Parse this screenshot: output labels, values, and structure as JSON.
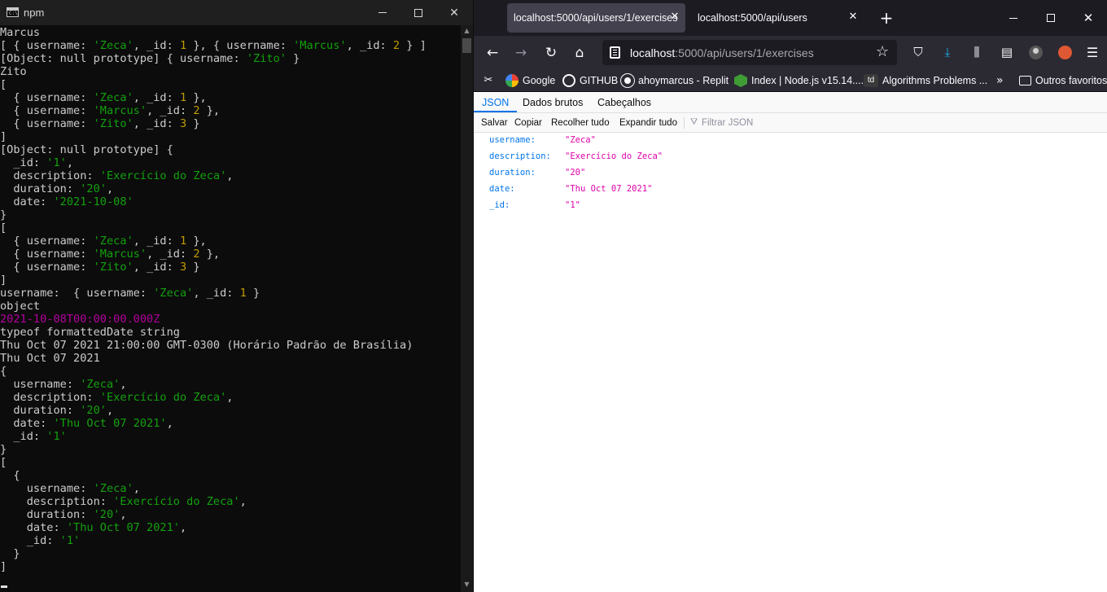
{
  "terminal": {
    "title": "npm",
    "icon_text": "C:\\",
    "lines": [
      [
        {
          "t": "Marcus"
        }
      ],
      [
        {
          "t": "[ { username: "
        },
        {
          "t": "'Zeca'",
          "c": "str"
        },
        {
          "t": ", _id: "
        },
        {
          "t": "1",
          "c": "num"
        },
        {
          "t": " }, { username: "
        },
        {
          "t": "'Marcus'",
          "c": "str"
        },
        {
          "t": ", _id: "
        },
        {
          "t": "2",
          "c": "num"
        },
        {
          "t": " } ]"
        }
      ],
      [
        {
          "t": "[Object: null prototype] { username: "
        },
        {
          "t": "'Zito'",
          "c": "str"
        },
        {
          "t": " }"
        }
      ],
      [
        {
          "t": "Zito"
        }
      ],
      [
        {
          "t": "["
        }
      ],
      [
        {
          "t": "  { username: "
        },
        {
          "t": "'Zeca'",
          "c": "str"
        },
        {
          "t": ", _id: "
        },
        {
          "t": "1",
          "c": "num"
        },
        {
          "t": " },"
        }
      ],
      [
        {
          "t": "  { username: "
        },
        {
          "t": "'Marcus'",
          "c": "str"
        },
        {
          "t": ", _id: "
        },
        {
          "t": "2",
          "c": "num"
        },
        {
          "t": " },"
        }
      ],
      [
        {
          "t": "  { username: "
        },
        {
          "t": "'Zito'",
          "c": "str"
        },
        {
          "t": ", _id: "
        },
        {
          "t": "3",
          "c": "num"
        },
        {
          "t": " }"
        }
      ],
      [
        {
          "t": "]"
        }
      ],
      [
        {
          "t": "[Object: null prototype] {"
        }
      ],
      [
        {
          "t": "  _id: "
        },
        {
          "t": "'1'",
          "c": "str"
        },
        {
          "t": ","
        }
      ],
      [
        {
          "t": "  description: "
        },
        {
          "t": "'Exercício do Zeca'",
          "c": "str"
        },
        {
          "t": ","
        }
      ],
      [
        {
          "t": "  duration: "
        },
        {
          "t": "'20'",
          "c": "str"
        },
        {
          "t": ","
        }
      ],
      [
        {
          "t": "  date: "
        },
        {
          "t": "'2021-10-08'",
          "c": "str"
        }
      ],
      [
        {
          "t": "}"
        }
      ],
      [
        {
          "t": "["
        }
      ],
      [
        {
          "t": "  { username: "
        },
        {
          "t": "'Zeca'",
          "c": "str"
        },
        {
          "t": ", _id: "
        },
        {
          "t": "1",
          "c": "num"
        },
        {
          "t": " },"
        }
      ],
      [
        {
          "t": "  { username: "
        },
        {
          "t": "'Marcus'",
          "c": "str"
        },
        {
          "t": ", _id: "
        },
        {
          "t": "2",
          "c": "num"
        },
        {
          "t": " },"
        }
      ],
      [
        {
          "t": "  { username: "
        },
        {
          "t": "'Zito'",
          "c": "str"
        },
        {
          "t": ", _id: "
        },
        {
          "t": "3",
          "c": "num"
        },
        {
          "t": " }"
        }
      ],
      [
        {
          "t": "]"
        }
      ],
      [
        {
          "t": "username:  { username: "
        },
        {
          "t": "'Zeca'",
          "c": "str"
        },
        {
          "t": ", _id: "
        },
        {
          "t": "1",
          "c": "num"
        },
        {
          "t": " }"
        }
      ],
      [
        {
          "t": "object"
        }
      ],
      [
        {
          "t": "2021-10-08T00:00:00.000Z",
          "c": "mag"
        }
      ],
      [
        {
          "t": "typeof formattedDate string"
        }
      ],
      [
        {
          "t": "Thu Oct 07 2021 21:00:00 GMT-0300 (Horário Padrão de Brasília)"
        }
      ],
      [
        {
          "t": "Thu Oct 07 2021"
        }
      ],
      [
        {
          "t": "{"
        }
      ],
      [
        {
          "t": "  username: "
        },
        {
          "t": "'Zeca'",
          "c": "str"
        },
        {
          "t": ","
        }
      ],
      [
        {
          "t": "  description: "
        },
        {
          "t": "'Exercício do Zeca'",
          "c": "str"
        },
        {
          "t": ","
        }
      ],
      [
        {
          "t": "  duration: "
        },
        {
          "t": "'20'",
          "c": "str"
        },
        {
          "t": ","
        }
      ],
      [
        {
          "t": "  date: "
        },
        {
          "t": "'Thu Oct 07 2021'",
          "c": "str"
        },
        {
          "t": ","
        }
      ],
      [
        {
          "t": "  _id: "
        },
        {
          "t": "'1'",
          "c": "str"
        }
      ],
      [
        {
          "t": "}"
        }
      ],
      [
        {
          "t": "["
        }
      ],
      [
        {
          "t": "  {"
        }
      ],
      [
        {
          "t": "    username: "
        },
        {
          "t": "'Zeca'",
          "c": "str"
        },
        {
          "t": ","
        }
      ],
      [
        {
          "t": "    description: "
        },
        {
          "t": "'Exercício do Zeca'",
          "c": "str"
        },
        {
          "t": ","
        }
      ],
      [
        {
          "t": "    duration: "
        },
        {
          "t": "'20'",
          "c": "str"
        },
        {
          "t": ","
        }
      ],
      [
        {
          "t": "    date: "
        },
        {
          "t": "'Thu Oct 07 2021'",
          "c": "str"
        },
        {
          "t": ","
        }
      ],
      [
        {
          "t": "    _id: "
        },
        {
          "t": "'1'",
          "c": "str"
        }
      ],
      [
        {
          "t": "  }"
        }
      ],
      [
        {
          "t": "]"
        }
      ]
    ]
  },
  "browser": {
    "tabs": [
      {
        "label": "localhost:5000/api/users/1/exercises",
        "active": true
      },
      {
        "label": "localhost:5000/api/users",
        "active": false
      }
    ],
    "url": {
      "host": "localhost",
      "path": ":5000/api/users/1/exercises"
    },
    "bookmarks": {
      "google": "Google",
      "github": "GITHUB",
      "replit": "ahoymarcus - Replit",
      "node": "Index | Node.js v15.14....",
      "algo": "Algorithms Problems ...",
      "algo_icon": "td",
      "folder": "Outros favoritos"
    },
    "json_viewer": {
      "tabs": {
        "json": "JSON",
        "raw": "Dados brutos",
        "headers": "Cabeçalhos"
      },
      "toolbar": {
        "save": "Salvar",
        "copy": "Copiar",
        "collapse": "Recolher tudo",
        "expand": "Expandir tudo"
      },
      "filter_placeholder": "Filtrar JSON",
      "rows": [
        {
          "key": "username:",
          "value": "\"Zeca\""
        },
        {
          "key": "description:",
          "value": "\"Exercício do Zeca\""
        },
        {
          "key": "duration:",
          "value": "\"20\""
        },
        {
          "key": "date:",
          "value": "\"Thu Oct 07 2021\""
        },
        {
          "key": "_id:",
          "value": "\"1\""
        }
      ]
    }
  },
  "colors": {
    "terminal_string": "#13a10e",
    "terminal_number": "#c19c00",
    "terminal_date": "#b4009e",
    "json_key": "#0074e8",
    "json_value": "#dd00a9"
  }
}
